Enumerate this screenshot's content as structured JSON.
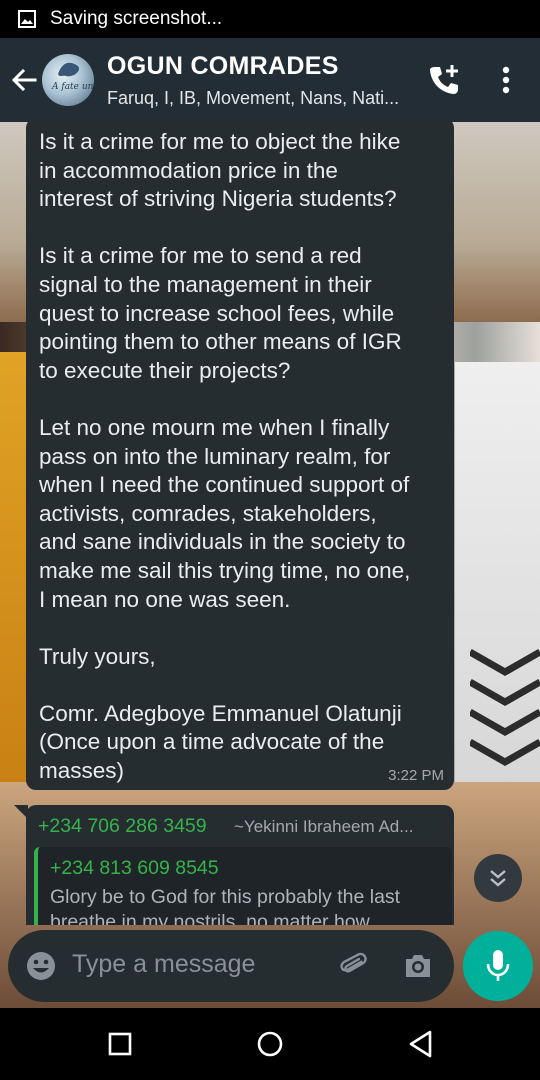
{
  "status_bar": {
    "text": "Saving screenshot..."
  },
  "header": {
    "title": "OGUN COMRADES",
    "members": "Faruq, I, IB, Movement, Nans, Nati...",
    "avatar_text": "A fate unknown"
  },
  "messages": [
    {
      "text": "Is it a crime for me to object the hike\nin accommodation price in the\ninterest of striving Nigeria students?\n\nIs it a crime for me to send a red\nsignal to the management in their\nquest to increase school fees, while\npointing them to other means of IGR\nto execute their projects?\n\nLet no one mourn me when I finally\npass on into the luminary realm, for\nwhen I need the continued support of\nactivists, comrades, stakeholders,\nand sane individuals in the society to\nmake me sail this trying time, no one,\nI mean no one was seen.\n\nTruly yours,\n\nComr. Adegboye Emmanuel Olatunji\n(Once upon a time advocate of the\nmasses)",
      "time": "3:22 PM"
    }
  ],
  "reply_message": {
    "sender_phone": "+234 706 286 3459",
    "sender_name": "~Yekinni Ibraheem Ad...",
    "quoted_phone": "+234 813 609 8545",
    "quoted_text": "Glory be to God for this probably the last breathe in my nostrils, no matter how"
  },
  "input": {
    "placeholder": "Type a message"
  },
  "icons": {
    "status": "image-icon",
    "back": "arrow-left-icon",
    "call": "add-call-icon",
    "menu": "more-vert-icon",
    "scroll": "double-chevron-down-icon",
    "emoji": "emoji-icon",
    "attach": "paperclip-icon",
    "camera": "camera-icon",
    "mic": "mic-icon"
  },
  "colors": {
    "header_bg": "#232d35",
    "bubble_bg": "#262d31",
    "accent_green": "#35b34a",
    "mic_bg": "#00b09b"
  }
}
